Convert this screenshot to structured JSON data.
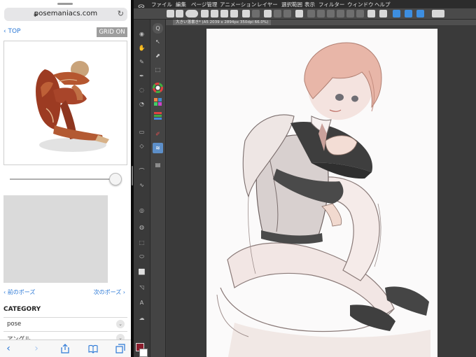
{
  "safari": {
    "url": "posemaniacs.com",
    "reload_icon": "reload-icon",
    "top_link": "TOP",
    "grid_button": "GRID ON",
    "slider": {
      "value": 0.96
    },
    "prev_pose": "前のポーズ",
    "next_pose": "次のポーズ",
    "category_title": "CATEGORY",
    "categories": [
      "pose",
      "アングル"
    ],
    "toolbar": [
      "back-icon",
      "forward-icon",
      "share-icon",
      "bookmarks-icon",
      "tabs-icon"
    ]
  },
  "csp": {
    "menu": [
      "ファイル",
      "編集",
      "ページ管理",
      "アニメーション",
      "レイヤー",
      "選択範囲",
      "表示",
      "フィルター",
      "ウィンドウ",
      "ヘルプ"
    ],
    "tab_title": "大きい落書き* (A5 2039 x 2894px 350dpi 66.0%)",
    "colors": {
      "main": "#8b1d2d",
      "sub": "#ffffff",
      "selected_tool": "#5d8fc9"
    }
  }
}
